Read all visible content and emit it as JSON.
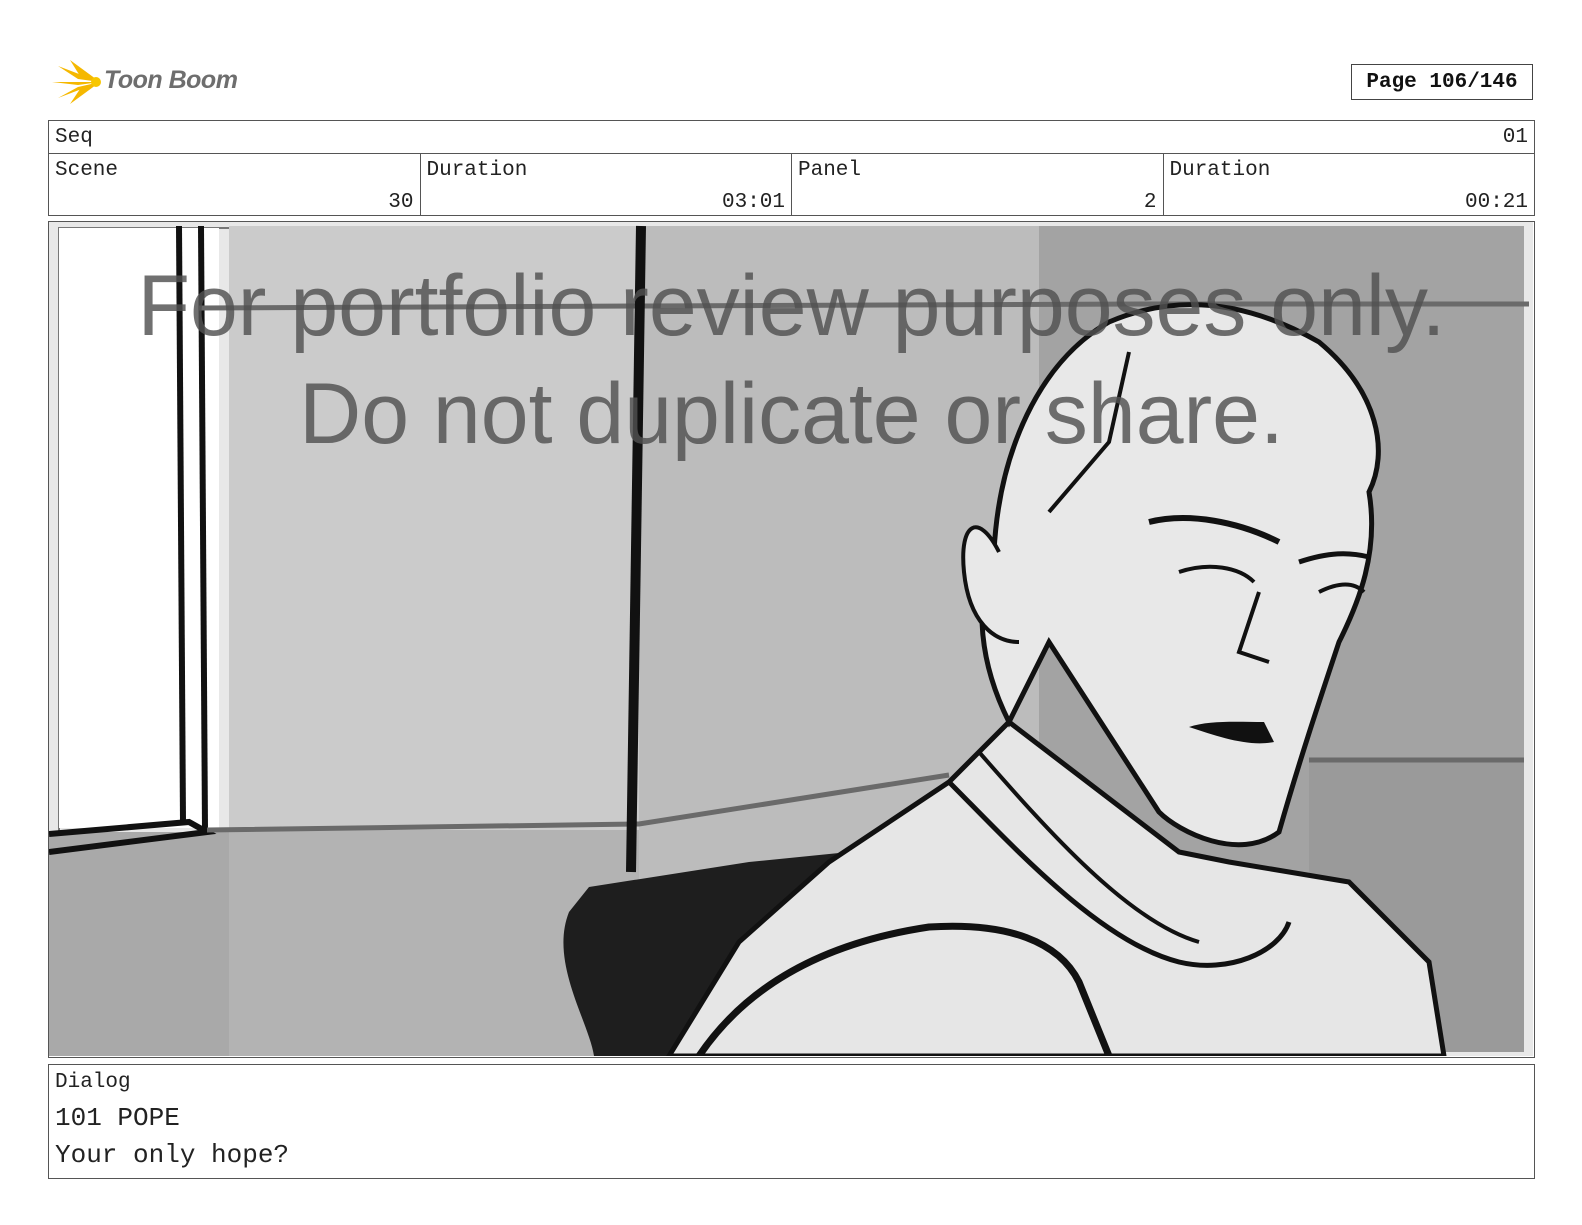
{
  "logo": {
    "text": "Toon Boom",
    "icon": "starburst-logo-icon",
    "color": "#f5b800"
  },
  "page": {
    "label": "Page 106/146"
  },
  "meta": {
    "seq_label": "Seq",
    "seq_value": "01",
    "scene_label": "Scene",
    "scene_value": "30",
    "duration1_label": "Duration",
    "duration1_value": "03:01",
    "panel_label": "Panel",
    "panel_value": "2",
    "duration2_label": "Duration",
    "duration2_value": "00:21"
  },
  "watermark": {
    "line1": "For portfolio review purposes only.",
    "line2": "Do not duplicate or share."
  },
  "dialog": {
    "label": "Dialog",
    "line1": "101 POPE",
    "line2": "Your only hope?"
  }
}
